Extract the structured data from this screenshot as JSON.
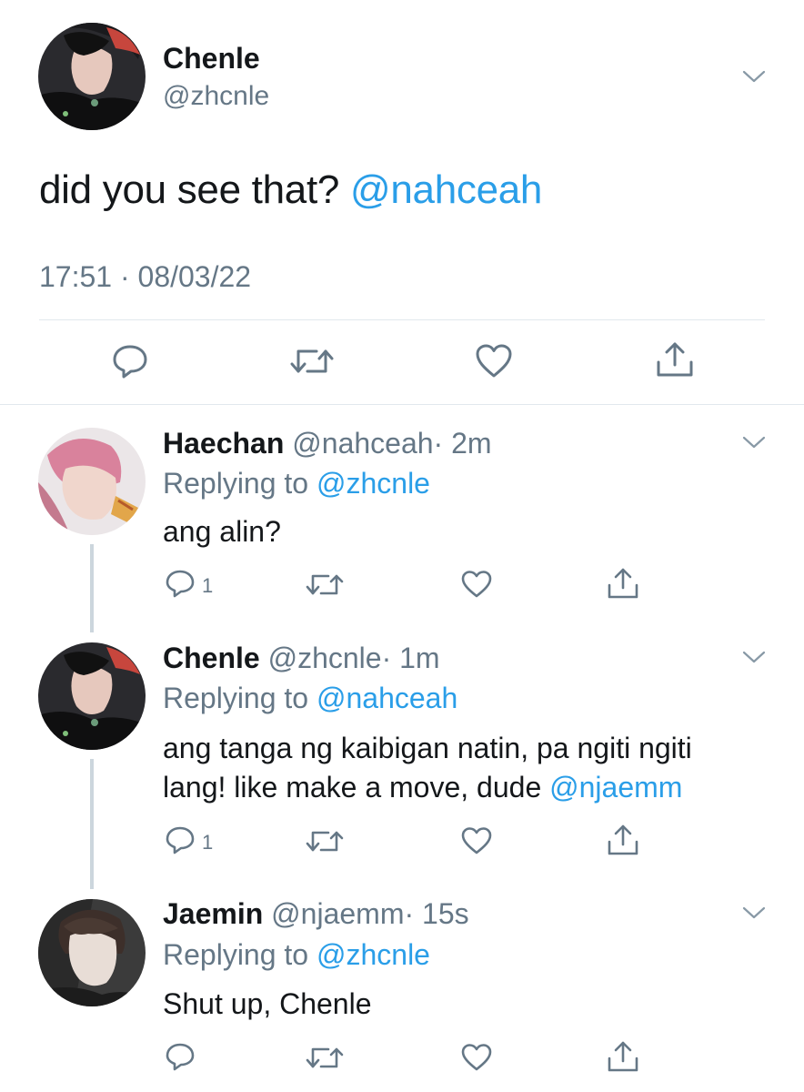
{
  "main_tweet": {
    "display_name": "Chenle",
    "handle": "@zhcnle",
    "text": "did you see that?",
    "mention": "@nahceah",
    "timestamp": "17:51 · 08/03/22"
  },
  "replies": [
    {
      "display_name": "Haechan",
      "handle": "@nahceah",
      "time": "· 2m",
      "replying_prefix": "Replying to",
      "replying_to": "@zhcnle",
      "text": "ang alin?",
      "reply_count": "1"
    },
    {
      "display_name": "Chenle",
      "handle": "@zhcnle",
      "time": "· 1m",
      "replying_prefix": "Replying to",
      "replying_to": "@nahceah",
      "text_line1": "ang tanga ng kaibigan natin, pa ngiti ngiti",
      "text_line2": "lang! like make a move, dude",
      "mention": "@njaemm",
      "reply_count": "1"
    },
    {
      "display_name": "Jaemin",
      "handle": "@njaemm",
      "time": "· 15s",
      "replying_prefix": "Replying to",
      "replying_to": "@zhcnle",
      "text": "Shut up, Chenle",
      "reply_count": ""
    }
  ],
  "icons": {
    "reply": "reply-icon",
    "retweet": "retweet-icon",
    "like": "heart-icon",
    "share": "share-icon",
    "more": "chevron-down-icon"
  },
  "colors": {
    "link": "#2a9ee8",
    "muted": "#657786",
    "divider": "#e1e8ed",
    "thread_line": "#ccd6dd"
  }
}
